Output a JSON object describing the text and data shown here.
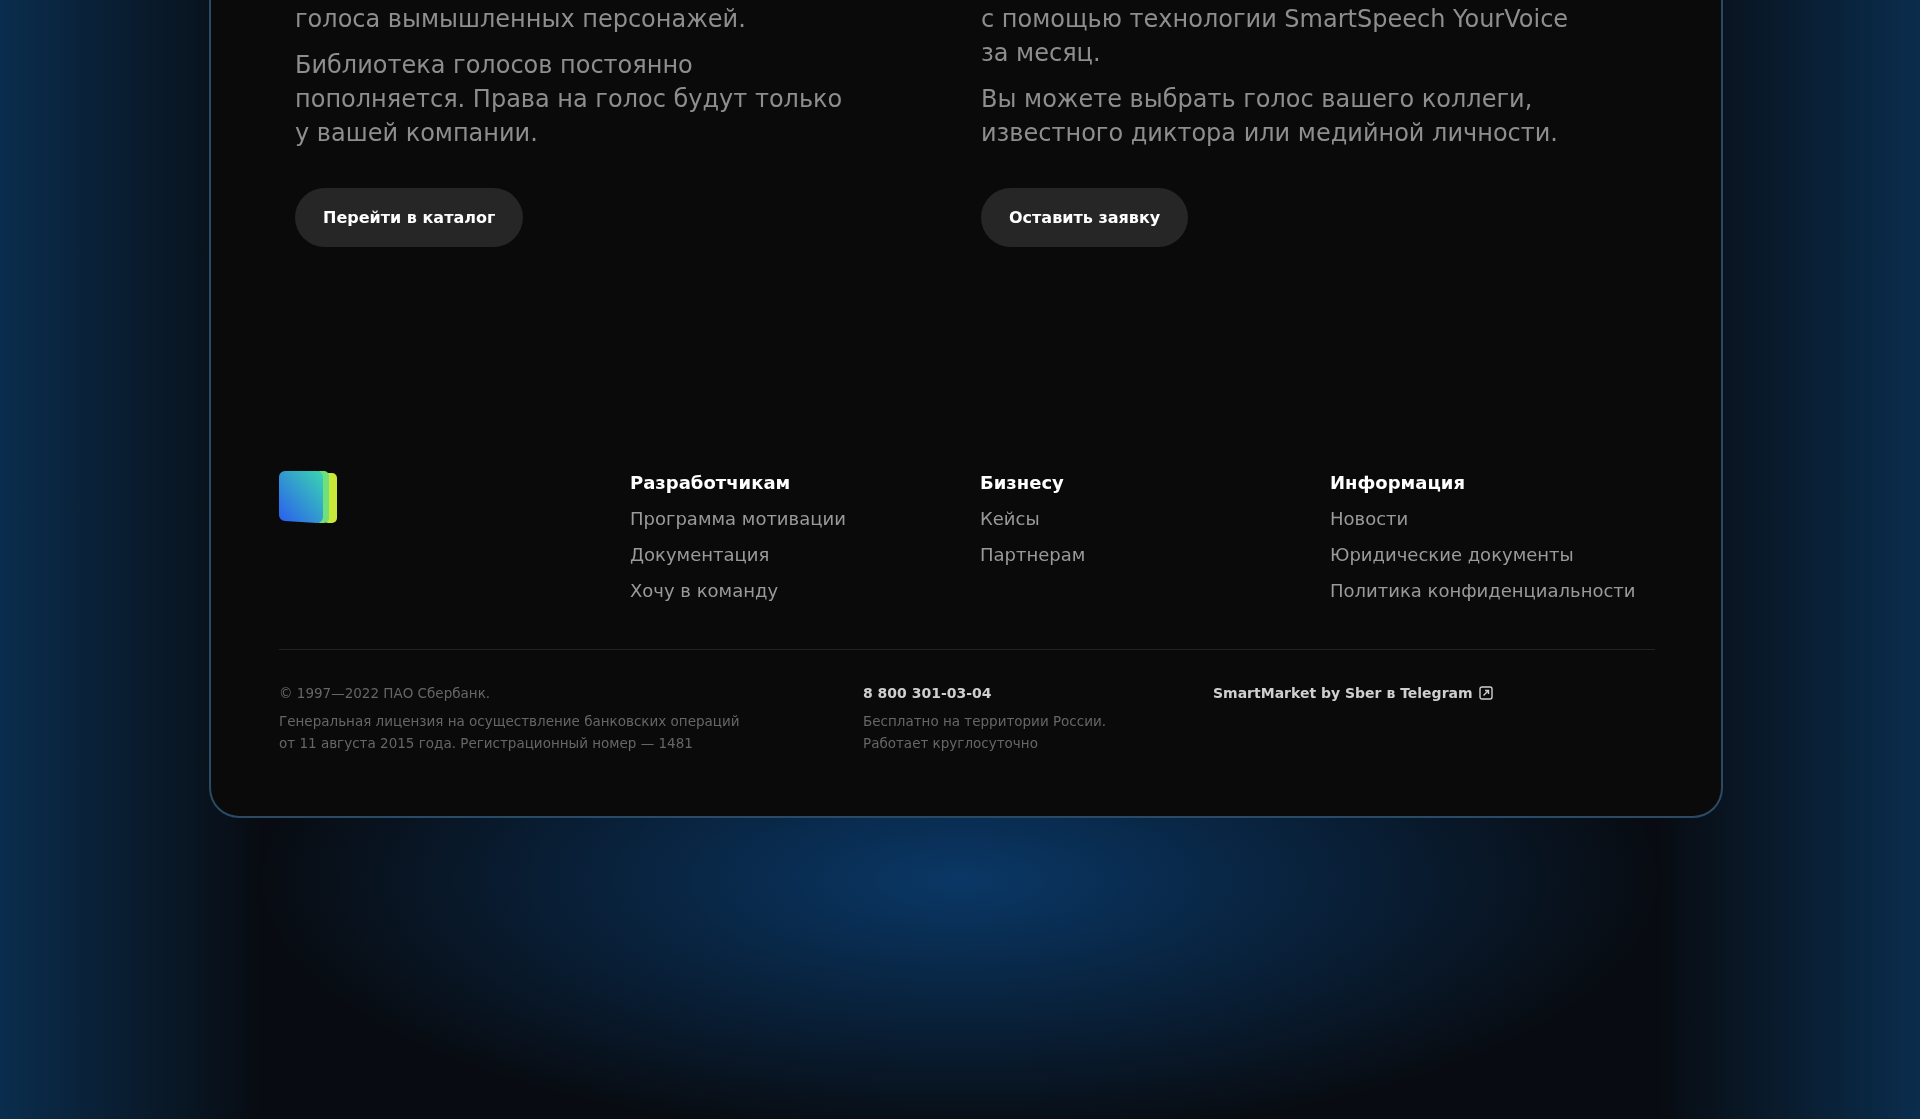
{
  "promo_columns": [
    {
      "paragraphs": [
        "голоса вымышленных персонажей.",
        "Библиотека голосов постоянно пополняется. Права на голос будут только у вашей компании."
      ],
      "button": "Перейти в каталог"
    },
    {
      "paragraphs": [
        "с помощью технологии SmartSpeech YourVoice за месяц.",
        "Вы можете выбрать голос вашего коллеги, известного диктора или медийной личности."
      ],
      "button": "Оставить заявку"
    }
  ],
  "footer": {
    "nav_columns": [
      {
        "heading": "Разработчикам",
        "links": [
          "Программа мотивации",
          "Документация",
          "Хочу в команду"
        ]
      },
      {
        "heading": "Бизнесу",
        "links": [
          "Кейсы",
          "Партнерам"
        ]
      },
      {
        "heading": "Информация",
        "links": [
          "Новости",
          "Юридические документы",
          "Политика конфиденциальности"
        ]
      }
    ],
    "copyright": "© 1997—2022 ПАО Сбербанк.",
    "license": "Генеральная лицензия на осуществление банковских операций от 11 августа 2015 года. Регистрационный номер — 1481",
    "phone": "8 800 301-03-04",
    "phone_note": "Бесплатно на территории России. Работает круглосуточно",
    "telegram_link": "SmartMarket by Sber в Telegram"
  }
}
